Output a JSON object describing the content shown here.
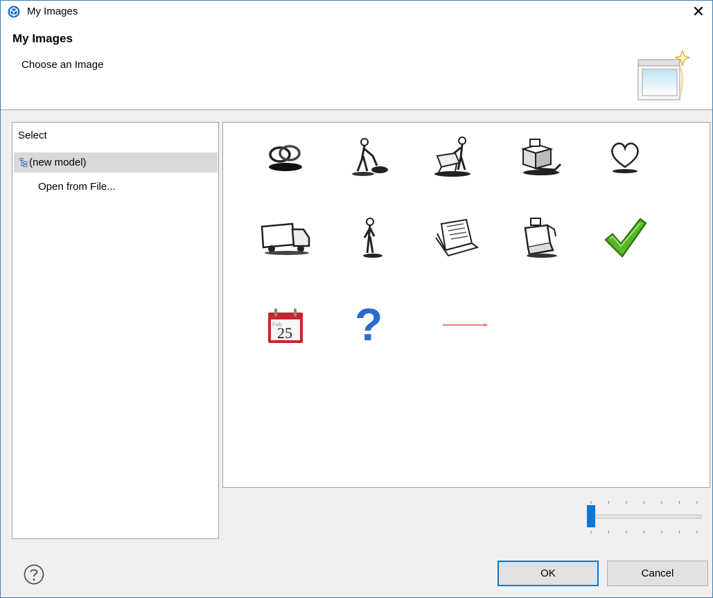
{
  "window": {
    "title": "My Images",
    "close_glyph": "✕"
  },
  "header": {
    "title": "My Images",
    "subtitle": "Choose an Image"
  },
  "left_panel": {
    "label": "Select",
    "items": [
      {
        "label": "(new model)",
        "selected": true,
        "icon": "tree-model-icon"
      },
      {
        "label": "Open from File...",
        "selected": false
      }
    ]
  },
  "gallery": {
    "items": [
      {
        "icon": "rings-icon"
      },
      {
        "icon": "person-vacuuming-icon"
      },
      {
        "icon": "person-pushing-cart-icon"
      },
      {
        "icon": "pallet-of-boxes-icon"
      },
      {
        "icon": "heart-icon"
      },
      {
        "icon": "delivery-truck-icon"
      },
      {
        "icon": "standing-person-icon"
      },
      {
        "icon": "papers-stack-icon"
      },
      {
        "icon": "cash-register-icon"
      },
      {
        "icon": "checkmark-icon"
      },
      {
        "icon": "calendar-icon",
        "text": "25",
        "subtext": "Feb"
      },
      {
        "icon": "question-mark-icon",
        "text": "?"
      },
      {
        "icon": "red-line-arrow-icon"
      }
    ]
  },
  "slider": {
    "value_fraction": 0.0
  },
  "buttons": {
    "ok": "OK",
    "cancel": "Cancel"
  },
  "colors": {
    "accent": "#0078d7",
    "check": "#5ab52a",
    "calendar_red": "#c8262c",
    "question_blue": "#2b6bc9"
  }
}
